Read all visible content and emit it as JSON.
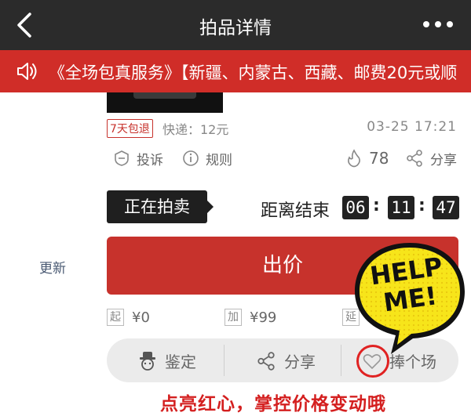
{
  "header": {
    "title": "拍品详情",
    "back_icon": "chevron-left-icon",
    "more_icon": "more-dots-icon"
  },
  "notice": {
    "icon": "speaker-icon",
    "text": "《全场包真服务》【新疆、内蒙古、西藏、邮费20元或顺"
  },
  "item": {
    "tag": "7天包退",
    "shipping": "快递：12元",
    "time": "03-25  17:21"
  },
  "actions": {
    "complaint": "投诉",
    "rules": "规则",
    "heat": "78",
    "share": "分享"
  },
  "auction": {
    "status": "正在拍卖",
    "countdown_label": "距离结束",
    "countdown": {
      "h": "06",
      "m": "11",
      "s": "47"
    },
    "update": "更新",
    "bid_button": "出价"
  },
  "bid_rules": {
    "start_tag": "起",
    "start_value": "¥0",
    "increment_tag": "加",
    "increment_value": "¥99",
    "delay_tag": "延"
  },
  "bottom_bar": {
    "appraise": "鉴定",
    "share": "分享",
    "favorite": "捧个场"
  },
  "sticker": {
    "line1": "HELP",
    "line2": "ME!"
  },
  "promo": "点亮红心，掌控价格变动哦",
  "colors": {
    "accent_red": "#c7322c",
    "topbar": "#2b2b2b",
    "sticker_yellow": "#f7e51a"
  }
}
